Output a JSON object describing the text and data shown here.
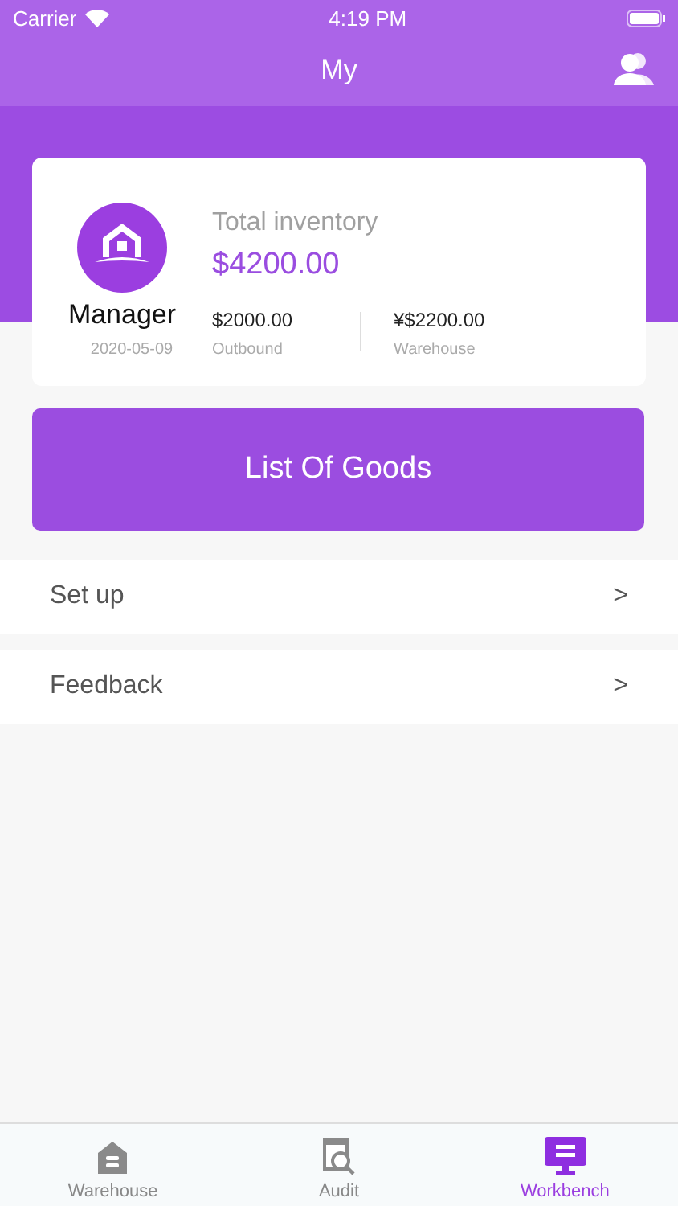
{
  "status_bar": {
    "carrier": "Carrier",
    "time": "4:19 PM"
  },
  "nav_bar": {
    "title": "My"
  },
  "profile_card": {
    "role": "Manager",
    "date": "2020-05-09",
    "total_label": "Total inventory",
    "total_value": "$4200.00",
    "stats": [
      {
        "value": "$2000.00",
        "label": "Outbound"
      },
      {
        "value": "¥$2200.00",
        "label": "Warehouse"
      }
    ]
  },
  "primary_button": "List Of Goods",
  "menu": [
    {
      "label": "Set up",
      "chevron": ">"
    },
    {
      "label": "Feedback",
      "chevron": ">"
    }
  ],
  "tab_bar": [
    {
      "kind": "warehouse",
      "label": "Warehouse",
      "selected": false
    },
    {
      "kind": "audit",
      "label": "Audit",
      "selected": false
    },
    {
      "kind": "workbench",
      "label": "Workbench",
      "selected": true
    }
  ]
}
